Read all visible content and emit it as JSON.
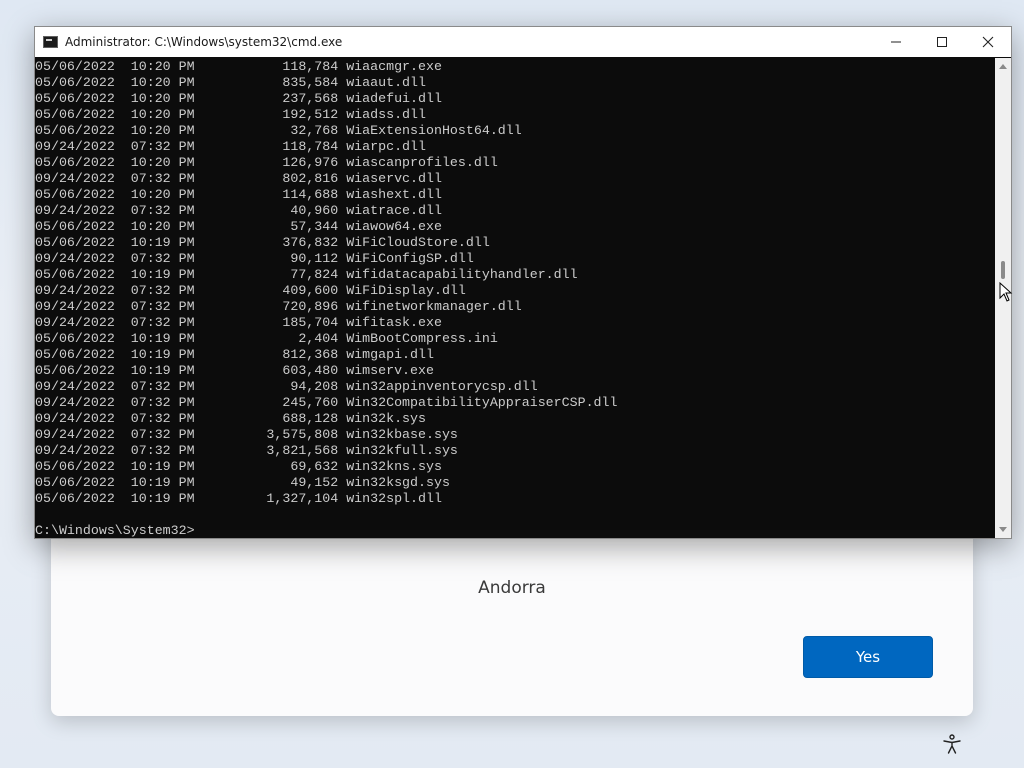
{
  "window": {
    "title": "Administrator: C:\\Windows\\system32\\cmd.exe",
    "icon": "cmd-icon"
  },
  "console": {
    "lines": [
      {
        "date": "05/06/2022",
        "time": "10:20 PM",
        "size": "118,784",
        "name": "wiaacmgr.exe"
      },
      {
        "date": "05/06/2022",
        "time": "10:20 PM",
        "size": "835,584",
        "name": "wiaaut.dll"
      },
      {
        "date": "05/06/2022",
        "time": "10:20 PM",
        "size": "237,568",
        "name": "wiadefui.dll"
      },
      {
        "date": "05/06/2022",
        "time": "10:20 PM",
        "size": "192,512",
        "name": "wiadss.dll"
      },
      {
        "date": "05/06/2022",
        "time": "10:20 PM",
        "size": "32,768",
        "name": "WiaExtensionHost64.dll"
      },
      {
        "date": "09/24/2022",
        "time": "07:32 PM",
        "size": "118,784",
        "name": "wiarpc.dll"
      },
      {
        "date": "05/06/2022",
        "time": "10:20 PM",
        "size": "126,976",
        "name": "wiascanprofiles.dll"
      },
      {
        "date": "09/24/2022",
        "time": "07:32 PM",
        "size": "802,816",
        "name": "wiaservc.dll"
      },
      {
        "date": "05/06/2022",
        "time": "10:20 PM",
        "size": "114,688",
        "name": "wiashext.dll"
      },
      {
        "date": "09/24/2022",
        "time": "07:32 PM",
        "size": "40,960",
        "name": "wiatrace.dll"
      },
      {
        "date": "05/06/2022",
        "time": "10:20 PM",
        "size": "57,344",
        "name": "wiawow64.exe"
      },
      {
        "date": "05/06/2022",
        "time": "10:19 PM",
        "size": "376,832",
        "name": "WiFiCloudStore.dll"
      },
      {
        "date": "09/24/2022",
        "time": "07:32 PM",
        "size": "90,112",
        "name": "WiFiConfigSP.dll"
      },
      {
        "date": "05/06/2022",
        "time": "10:19 PM",
        "size": "77,824",
        "name": "wifidatacapabilityhandler.dll"
      },
      {
        "date": "09/24/2022",
        "time": "07:32 PM",
        "size": "409,600",
        "name": "WiFiDisplay.dll"
      },
      {
        "date": "09/24/2022",
        "time": "07:32 PM",
        "size": "720,896",
        "name": "wifinetworkmanager.dll"
      },
      {
        "date": "09/24/2022",
        "time": "07:32 PM",
        "size": "185,704",
        "name": "wifitask.exe"
      },
      {
        "date": "05/06/2022",
        "time": "10:19 PM",
        "size": "2,404",
        "name": "WimBootCompress.ini"
      },
      {
        "date": "05/06/2022",
        "time": "10:19 PM",
        "size": "812,368",
        "name": "wimgapi.dll"
      },
      {
        "date": "05/06/2022",
        "time": "10:19 PM",
        "size": "603,480",
        "name": "wimserv.exe"
      },
      {
        "date": "09/24/2022",
        "time": "07:32 PM",
        "size": "94,208",
        "name": "win32appinventorycsp.dll"
      },
      {
        "date": "09/24/2022",
        "time": "07:32 PM",
        "size": "245,760",
        "name": "Win32CompatibilityAppraiserCSP.dll"
      },
      {
        "date": "09/24/2022",
        "time": "07:32 PM",
        "size": "688,128",
        "name": "win32k.sys"
      },
      {
        "date": "09/24/2022",
        "time": "07:32 PM",
        "size": "3,575,808",
        "name": "win32kbase.sys"
      },
      {
        "date": "09/24/2022",
        "time": "07:32 PM",
        "size": "3,821,568",
        "name": "win32kfull.sys"
      },
      {
        "date": "05/06/2022",
        "time": "10:19 PM",
        "size": "69,632",
        "name": "win32kns.sys"
      },
      {
        "date": "05/06/2022",
        "time": "10:19 PM",
        "size": "49,152",
        "name": "win32ksgd.sys"
      },
      {
        "date": "05/06/2022",
        "time": "10:19 PM",
        "size": "1,327,104",
        "name": "win32spl.dll"
      }
    ],
    "prompt": "C:\\Windows\\System32>"
  },
  "oobe": {
    "country": "Andorra",
    "yes_label": "Yes"
  },
  "icons": {
    "accessibility": "accessibility-icon",
    "minimize": "minimize-icon",
    "maximize": "maximize-icon",
    "close": "close-icon"
  },
  "colors": {
    "console_bg": "#0c0c0c",
    "console_fg": "#cccccc",
    "accent": "#0067c0"
  }
}
